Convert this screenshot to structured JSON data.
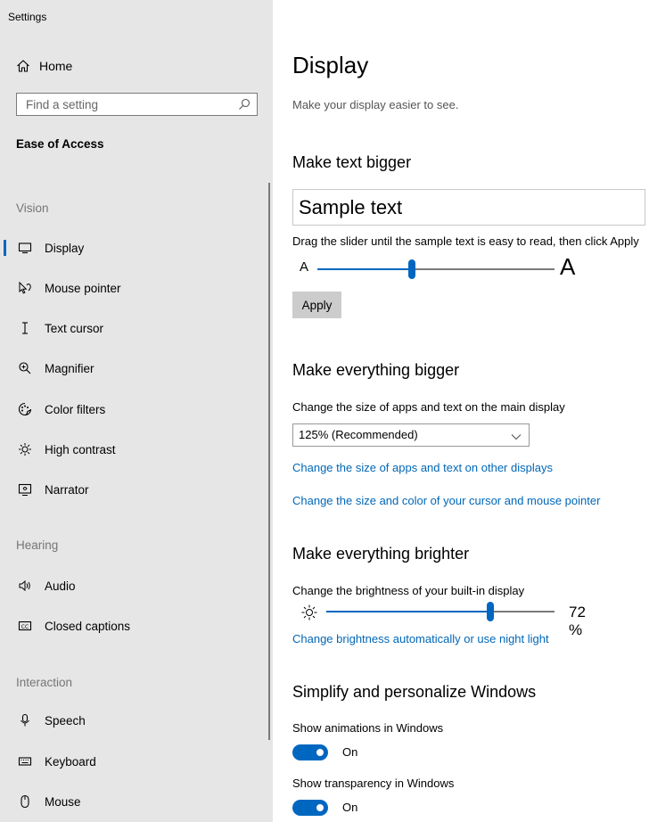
{
  "window": {
    "title": "Settings"
  },
  "sidebar": {
    "home_label": "Home",
    "search_placeholder": "Find a setting",
    "section_title": "Ease of Access",
    "groups": [
      {
        "label": "Vision",
        "items": [
          {
            "label": "Display",
            "icon": "monitor-icon",
            "selected": true
          },
          {
            "label": "Mouse pointer",
            "icon": "mouse-pointer-icon"
          },
          {
            "label": "Text cursor",
            "icon": "text-cursor-icon"
          },
          {
            "label": "Magnifier",
            "icon": "magnifier-icon"
          },
          {
            "label": "Color filters",
            "icon": "color-filters-icon"
          },
          {
            "label": "High contrast",
            "icon": "high-contrast-icon"
          },
          {
            "label": "Narrator",
            "icon": "narrator-icon"
          }
        ]
      },
      {
        "label": "Hearing",
        "items": [
          {
            "label": "Audio",
            "icon": "speaker-icon"
          },
          {
            "label": "Closed captions",
            "icon": "closed-captions-icon"
          }
        ]
      },
      {
        "label": "Interaction",
        "items": [
          {
            "label": "Speech",
            "icon": "microphone-icon"
          },
          {
            "label": "Keyboard",
            "icon": "keyboard-icon"
          },
          {
            "label": "Mouse",
            "icon": "mouse-icon"
          }
        ]
      }
    ]
  },
  "main": {
    "title": "Display",
    "subtitle": "Make your display easier to see.",
    "text_bigger": {
      "heading": "Make text bigger",
      "sample_text": "Sample text",
      "instruction": "Drag the slider until the sample text is easy to read, then click Apply",
      "small_a": "A",
      "large_a": "A",
      "slider_fraction": 0.4,
      "apply_label": "Apply"
    },
    "everything_bigger": {
      "heading": "Make everything bigger",
      "description": "Change the size of apps and text on the main display",
      "scale_value": "125% (Recommended)",
      "link_other_displays": "Change the size of apps and text on other displays",
      "link_cursor": "Change the size and color of your cursor and mouse pointer"
    },
    "brighter": {
      "heading": "Make everything brighter",
      "description": "Change the brightness of your built-in display",
      "brightness_percent": 72,
      "value_text": "72 %",
      "link_night_light": "Change brightness automatically or use night light"
    },
    "simplify": {
      "heading": "Simplify and personalize Windows",
      "animations_label": "Show animations in Windows",
      "animations_state": "On",
      "transparency_label": "Show transparency in Windows",
      "transparency_state": "On"
    }
  },
  "colors": {
    "accent": "#0067c0",
    "link": "#0067b8",
    "sidebar_bg": "#e6e6e6"
  }
}
